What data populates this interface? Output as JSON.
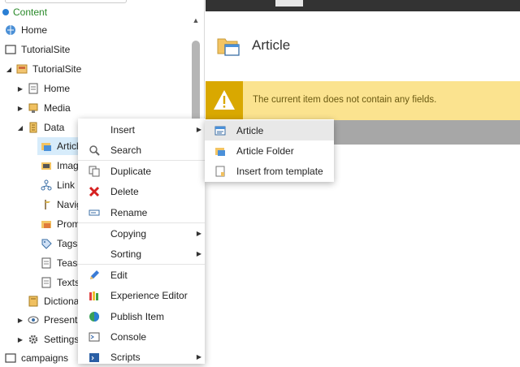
{
  "tree": {
    "content_label": "Content",
    "items": [
      {
        "label": "Home"
      },
      {
        "label": "TutorialSite"
      },
      {
        "label": "TutorialSite"
      },
      {
        "label": "Home"
      },
      {
        "label": "Media"
      },
      {
        "label": "Data"
      },
      {
        "label": "Articl"
      },
      {
        "label": "Imag"
      },
      {
        "label": "Link I"
      },
      {
        "label": "Navig"
      },
      {
        "label": "Prom"
      },
      {
        "label": "Tags"
      },
      {
        "label": "Tease"
      },
      {
        "label": "Texts"
      },
      {
        "label": "Dictiona"
      },
      {
        "label": "Presenta"
      },
      {
        "label": "Settings"
      },
      {
        "label": "campaigns"
      }
    ]
  },
  "header": {
    "title": "Article"
  },
  "warning": {
    "text": "The current item does not contain any fields."
  },
  "context_menu": {
    "items": [
      {
        "label": "Insert"
      },
      {
        "label": "Search"
      },
      {
        "label": "Duplicate"
      },
      {
        "label": "Delete"
      },
      {
        "label": "Rename"
      },
      {
        "label": "Copying"
      },
      {
        "label": "Sorting"
      },
      {
        "label": "Edit"
      },
      {
        "label": "Experience Editor"
      },
      {
        "label": "Publish Item"
      },
      {
        "label": "Console"
      },
      {
        "label": "Scripts"
      }
    ]
  },
  "submenu": {
    "items": [
      {
        "label": "Article"
      },
      {
        "label": "Article Folder"
      },
      {
        "label": "Insert from template"
      }
    ]
  },
  "colors": {
    "warning_bg": "#fbe38f",
    "warning_icon_bg": "#d9a800",
    "selected_bg": "#d7ecfb",
    "accent_green": "#2a8a2a"
  }
}
